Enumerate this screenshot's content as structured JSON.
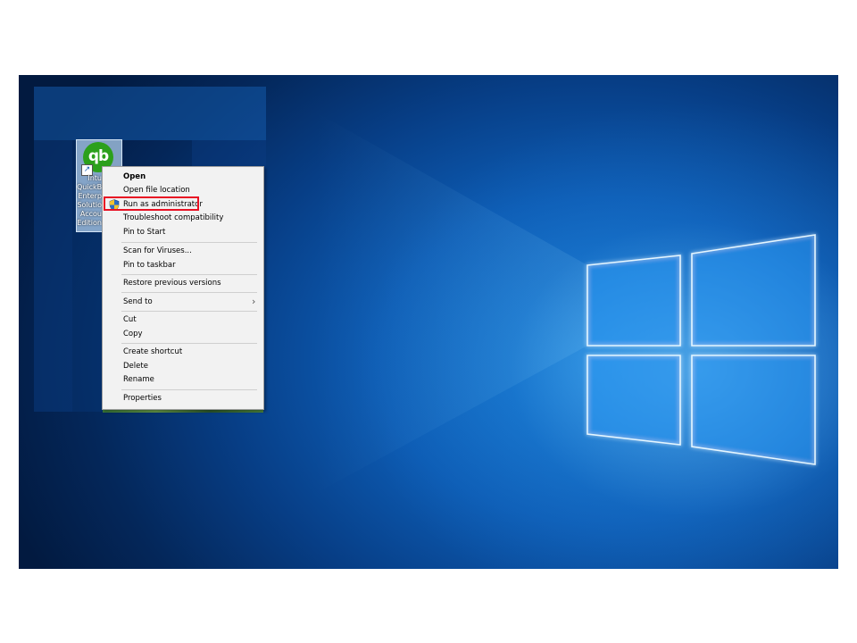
{
  "desktop": {
    "icon": {
      "logo_text": "qb",
      "label_lines": "Intu\nQuickB\nEnterp\nSolutio\nAccou\nEdition",
      "label_full_hint": ""
    }
  },
  "context_menu": {
    "items": [
      {
        "label": "Open",
        "bold": true
      },
      {
        "label": "Open file location"
      },
      {
        "label": "Run as administrator",
        "icon": "shield-icon",
        "highlighted": true
      },
      {
        "label": "Troubleshoot compatibility"
      },
      {
        "label": "Pin to Start"
      },
      {
        "label": "Scan for Viruses..."
      },
      {
        "label": "Pin to taskbar"
      },
      {
        "label": "Restore previous versions"
      },
      {
        "label": "Send to",
        "submenu": true
      },
      {
        "label": "Cut"
      },
      {
        "label": "Copy"
      },
      {
        "label": "Create shortcut"
      },
      {
        "label": "Delete"
      },
      {
        "label": "Rename"
      },
      {
        "label": "Properties"
      }
    ]
  },
  "colors": {
    "highlight_border": "#e81123",
    "qb_green": "#2ca01c",
    "desktop_blue": "#0d5cb4"
  }
}
